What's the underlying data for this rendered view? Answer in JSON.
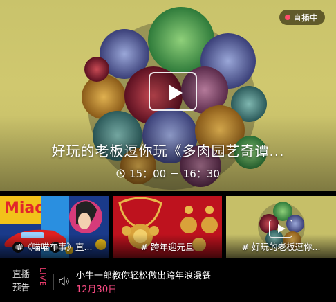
{
  "hero": {
    "badge": "直播中",
    "title": "好玩的老板逗你玩《多肉园艺奇谭...",
    "time": "15：00 － 16：30",
    "icons": {
      "play": "play-icon",
      "clock": "clock-icon"
    }
  },
  "thumbnails": [
    {
      "label": "#《喵喵车事》直..."
    },
    {
      "label": "# 跨年迎元旦"
    },
    {
      "label": "# 好玩的老板逗你..."
    }
  ],
  "bottom": {
    "pre_label": "直播预告",
    "live_tag": "LIVE",
    "program": "小牛一郎教你轻松做出跨年浪漫餐",
    "date": "12月30日"
  },
  "colors": {
    "accent": "#e63a6a",
    "date": "#ff4d86",
    "live_dot": "#ff4d6d"
  }
}
